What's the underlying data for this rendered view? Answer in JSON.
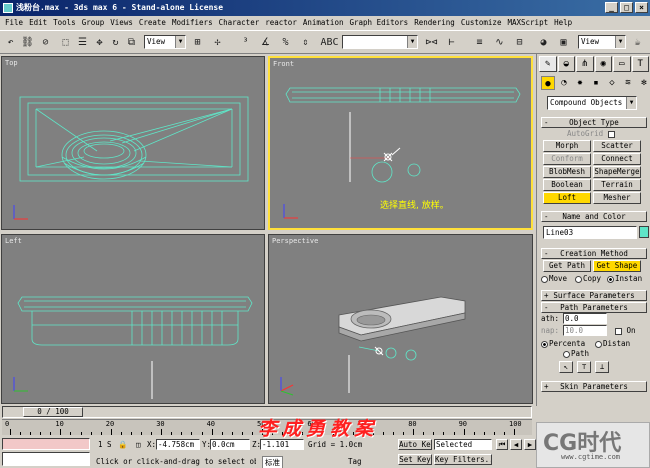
{
  "window": {
    "title": "浅粉台.max - 3ds max 6 - Stand-alone License",
    "min": "_",
    "max": "□",
    "close": "×"
  },
  "menu": [
    "File",
    "Edit",
    "Tools",
    "Group",
    "Views",
    "Create",
    "Modifiers",
    "Character",
    "reactor",
    "Animation",
    "Graph Editors",
    "Rendering",
    "Customize",
    "MAXScript",
    "Help"
  ],
  "toolbar": {
    "view_dropdown": "View",
    "view_dropdown2": "View"
  },
  "viewports": {
    "top": "Top",
    "front": "Front",
    "left": "Left",
    "perspective": "Perspective",
    "front_note": "选择直线, 放样。"
  },
  "command_panel": {
    "category": "Compound Objects",
    "object_type": {
      "title": "Object Type",
      "autogrid": "AutoGrid",
      "buttons": [
        "Morph",
        "Scatter",
        "Conform",
        "Connect",
        "BlobMesh",
        "ShapeMerge",
        "Boolean",
        "Terrain",
        "Loft",
        "Mesher"
      ]
    },
    "name_color": {
      "title": "Name and Color",
      "name": "Line03",
      "color": "#5fe6c8"
    },
    "creation": {
      "title": "Creation Method",
      "get_path": "Get Path",
      "get_shape": "Get Shape",
      "move": "Move",
      "copy": "Copy",
      "instance": "Instan"
    },
    "surface": {
      "title": "Surface Parameters"
    },
    "path": {
      "title": "Path Parameters",
      "path_label": "ath:",
      "path_value": "0.0",
      "snap_label": "nap:",
      "snap_value": "10.0",
      "on": "On",
      "percentage": "Percenta",
      "distance": "Distan",
      "path_steps": "Path"
    },
    "skin": {
      "title": "Skin Parameters"
    }
  },
  "timeline": {
    "frame": "0 / 100",
    "ticks": [
      "0",
      "10",
      "20",
      "30",
      "40",
      "50",
      "60",
      "70",
      "80",
      "90",
      "100"
    ]
  },
  "status": {
    "selected_count": "1 S",
    "x_label": "X:",
    "x": "-4.758cm",
    "y_label": "Y:",
    "y": "0.0cm",
    "z_label": "Z:",
    "z": "-1.101",
    "grid": "Grid = 1.0cm",
    "autokey": "Auto Key",
    "set_key": "Set Key",
    "selected": "Selected",
    "key_filters": "Key Filters...",
    "prompt": "Click or click-and-drag to select ob",
    "standard": "标准",
    "tag": "Tag"
  },
  "watermark": "李成勇教案",
  "logo": {
    "cg": "CG时代",
    "url": "www.cgtime.com"
  }
}
